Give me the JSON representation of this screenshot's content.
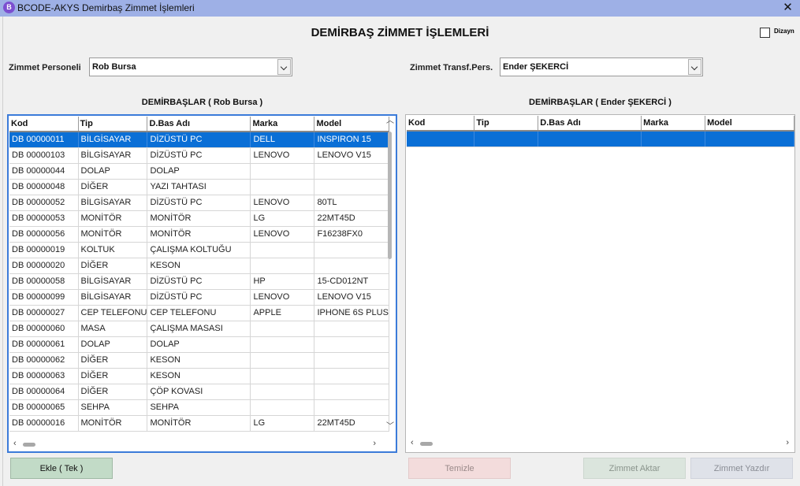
{
  "window": {
    "title": "BCODE-AKYS Demirbaş Zimmet İşlemleri",
    "app_icon_letter": "B",
    "close_label": "✕"
  },
  "page_title": "DEMİRBAŞ ZİMMET İŞLEMLERİ",
  "dizayn": {
    "label": "Dizayn",
    "checked": false
  },
  "left": {
    "personnel_label": "Zimmet Personeli",
    "personnel_value": "Rob Bursa",
    "grid_caption": "DEMİRBAŞLAR ( Rob Bursa )",
    "columns": [
      "Kod",
      "Tip",
      "D.Bas Adı",
      "Marka",
      "Model"
    ],
    "rows": [
      [
        "DB 00000011",
        "BİLGİSAYAR",
        "DİZÜSTÜ PC",
        "DELL",
        "INSPIRON 15"
      ],
      [
        "DB 00000103",
        "BİLGİSAYAR",
        "DİZÜSTÜ PC",
        "LENOVO",
        "LENOVO V15"
      ],
      [
        "DB 00000044",
        "DOLAP",
        "DOLAP",
        "",
        ""
      ],
      [
        "DB 00000048",
        "DİĞER",
        "YAZI TAHTASI",
        "",
        ""
      ],
      [
        "DB 00000052",
        "BİLGİSAYAR",
        "DİZÜSTÜ PC",
        "LENOVO",
        "80TL"
      ],
      [
        "DB 00000053",
        "MONİTÖR",
        "MONİTÖR",
        "LG",
        "22MT45D"
      ],
      [
        "DB 00000056",
        "MONİTÖR",
        "MONİTÖR",
        "LENOVO",
        "F16238FX0"
      ],
      [
        "DB 00000019",
        "KOLTUK",
        "ÇALIŞMA KOLTUĞU",
        "",
        ""
      ],
      [
        "DB 00000020",
        "DİĞER",
        "KESON",
        "",
        ""
      ],
      [
        "DB 00000058",
        "BİLGİSAYAR",
        "DİZÜSTÜ PC",
        "HP",
        "15-CD012NT"
      ],
      [
        "DB 00000099",
        "BİLGİSAYAR",
        "DİZÜSTÜ PC",
        "LENOVO",
        "LENOVO V15"
      ],
      [
        "DB 00000027",
        "CEP TELEFONU",
        "CEP TELEFONU",
        "APPLE",
        "IPHONE 6S PLUS"
      ],
      [
        "DB 00000060",
        "MASA",
        "ÇALIŞMA MASASI",
        "",
        ""
      ],
      [
        "DB 00000061",
        "DOLAP",
        "DOLAP",
        "",
        ""
      ],
      [
        "DB 00000062",
        "DİĞER",
        "KESON",
        "",
        ""
      ],
      [
        "DB 00000063",
        "DİĞER",
        "KESON",
        "",
        ""
      ],
      [
        "DB 00000064",
        "DİĞER",
        "ÇÖP KOVASI",
        "",
        ""
      ],
      [
        "DB 00000065",
        "SEHPA",
        "SEHPA",
        "",
        ""
      ],
      [
        "DB 00000016",
        "MONİTÖR",
        "MONİTÖR",
        "LG",
        "22MT45D"
      ]
    ],
    "selected_row": 0
  },
  "right": {
    "personnel_label": "Zimmet Transf.Pers.",
    "personnel_value": "Ender ŞEKERCİ",
    "grid_caption": "DEMİRBAŞLAR ( Ender ŞEKERCİ )",
    "columns": [
      "Kod",
      "Tip",
      "D.Bas Adı",
      "Marka",
      "Model"
    ],
    "rows": [],
    "selected_row": 0
  },
  "buttons": {
    "ekle": "Ekle ( Tek )",
    "temizle": "Temizle",
    "aktar": "Zimmet Aktar",
    "yazdir": "Zimmet Yazdır"
  },
  "colors": {
    "titlebar": "#9eb0e6",
    "selection": "#0a6fd6",
    "focused_grid_border": "#3b7bd9",
    "ekle_button": "#c2dbc7",
    "temizle_button": "#f3dcdc"
  }
}
